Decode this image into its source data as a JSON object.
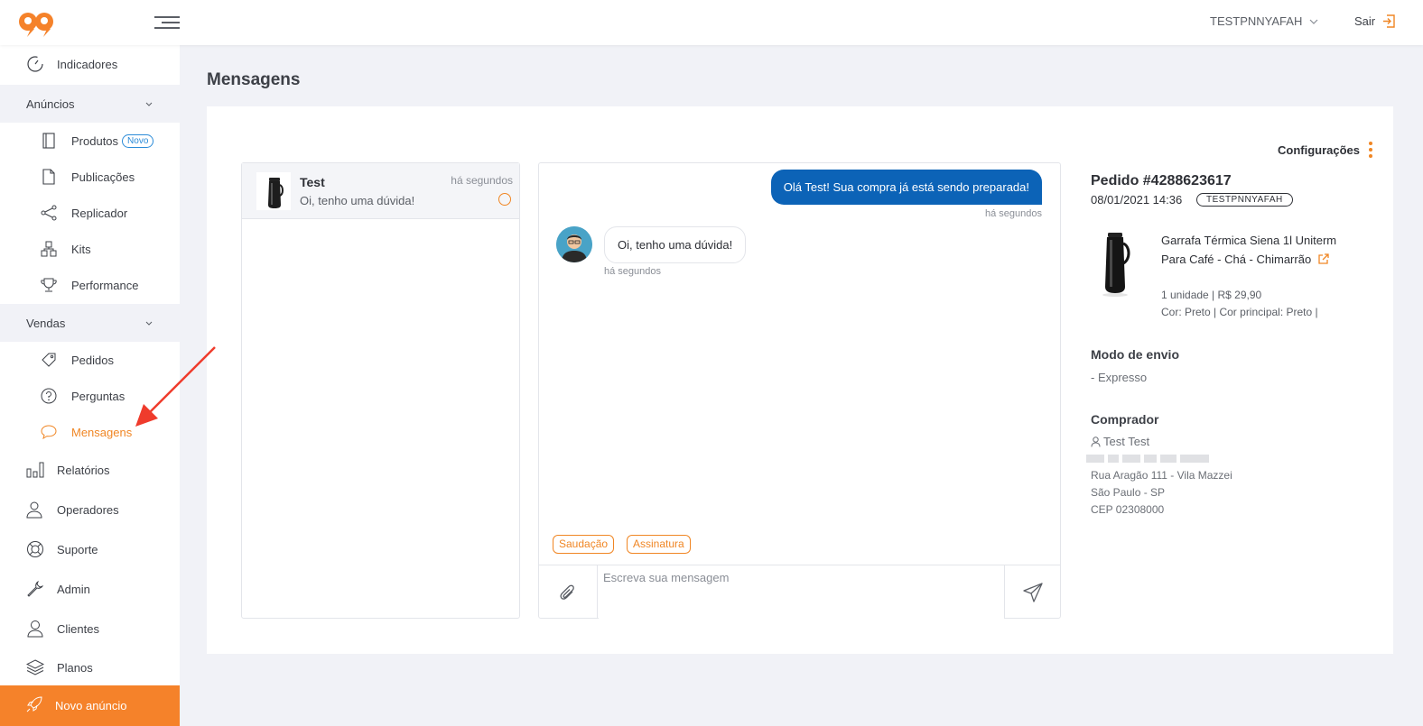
{
  "topbar": {
    "account_name": "TESTPNNYAFAH",
    "logout_label": "Sair"
  },
  "sidebar": {
    "items": [
      {
        "label": "Indicadores",
        "icon": "speedometer-icon"
      },
      {
        "label": "Anúncios",
        "icon": "chevron-down-icon"
      },
      {
        "label": "Produtos",
        "icon": "notebook-icon",
        "badge": "Novo"
      },
      {
        "label": "Publicações",
        "icon": "document-icon"
      },
      {
        "label": "Replicador",
        "icon": "share-icon"
      },
      {
        "label": "Kits",
        "icon": "boxes-icon"
      },
      {
        "label": "Performance",
        "icon": "trophy-icon"
      },
      {
        "label": "Vendas",
        "icon": "chevron-down-icon"
      },
      {
        "label": "Pedidos",
        "icon": "tag-icon"
      },
      {
        "label": "Perguntas",
        "icon": "question-icon"
      },
      {
        "label": "Mensagens",
        "icon": "chat-bubble-icon",
        "active": true
      },
      {
        "label": "Relatórios",
        "icon": "bar-chart-icon"
      },
      {
        "label": "Operadores",
        "icon": "users-icon"
      },
      {
        "label": "Suporte",
        "icon": "lifebuoy-icon"
      },
      {
        "label": "Admin",
        "icon": "wrench-icon"
      },
      {
        "label": "Clientes",
        "icon": "user-icon"
      },
      {
        "label": "Planos",
        "icon": "layers-icon"
      }
    ],
    "cta_label": "Novo anúncio",
    "accent_color": "#f5822a"
  },
  "page": {
    "title": "Mensagens"
  },
  "conversations": [
    {
      "name": "Test",
      "last_message": "Oi, tenho uma dúvida!",
      "time": "há segundos"
    }
  ],
  "chat": {
    "messages": [
      {
        "from": "seller",
        "text": "Olá Test! Sua compra já está sendo preparada!",
        "time": "há segundos"
      },
      {
        "from": "buyer",
        "text": "Oi, tenho uma dúvida!",
        "time": "há segundos"
      }
    ],
    "quick_replies": [
      "Saudação",
      "Assinatura"
    ],
    "input_placeholder": "Escreva sua mensagem",
    "outgoing_color": "#0c63b7"
  },
  "order": {
    "settings_label": "Configurações",
    "title": "Pedido #4288623617",
    "date": "08/01/2021 14:36",
    "badge": "TESTPNNYAFAH",
    "product": {
      "name": "Garrafa Térmica Siena 1l Uniterm Para Café - Chá - Chimarrão",
      "qty_price": "1 unidade | R$ 29,90",
      "attributes": "Cor: Preto | Cor principal: Preto |"
    },
    "shipping_title": "Modo de envio",
    "shipping_value": "- Expresso",
    "buyer_title": "Comprador",
    "buyer_name": "Test Test",
    "address_line1": "Rua Aragão 111 - Vila Mazzei",
    "address_line2": "São Paulo - SP",
    "address_line3": "CEP 02308000"
  }
}
